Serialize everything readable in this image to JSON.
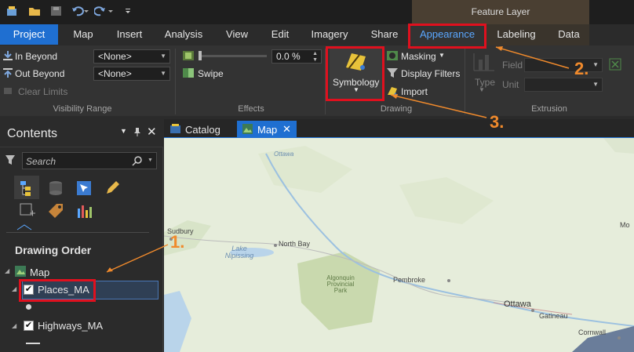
{
  "context_tab_group": "Feature Layer",
  "tabs": [
    "Project",
    "Map",
    "Insert",
    "Analysis",
    "View",
    "Edit",
    "Imagery",
    "Share",
    "Appearance",
    "Labeling",
    "Data"
  ],
  "ribbon": {
    "visibility_range": {
      "in_beyond": "In Beyond",
      "out_beyond": "Out Beyond",
      "clear_limits": "Clear Limits",
      "in_value": "<None>",
      "out_value": "<None>",
      "group_label": "Visibility Range"
    },
    "effects": {
      "transparency_value": "0.0 %",
      "swipe": "Swipe",
      "group_label": "Effects"
    },
    "drawing": {
      "symbology": "Symbology",
      "masking": "Masking",
      "display_filters": "Display Filters",
      "import": "Import",
      "group_label": "Drawing"
    },
    "extrusion": {
      "type": "Type",
      "field": "Field",
      "unit": "Unit",
      "group_label": "Extrusion"
    }
  },
  "contents": {
    "title": "Contents",
    "search_placeholder": "Search",
    "drawing_order": "Drawing Order",
    "map_label": "Map",
    "layers": [
      {
        "name": "Places_MA",
        "checked": true
      },
      {
        "name": "Highways_MA",
        "checked": true
      }
    ]
  },
  "view_tabs": [
    {
      "label": "Catalog"
    },
    {
      "label": "Map"
    }
  ],
  "map_labels": {
    "sudbury": "Sudbury",
    "north_bay": "North Bay",
    "lake_nipissing": "Lake Nipissing",
    "algonquin": "Algonquin Provincial Park",
    "pembroke": "Pembroke",
    "ottawa": "Ottawa",
    "gatineau": "Gatineau",
    "cornwall": "Cornwall",
    "ottawa_river": "Ottawa",
    "montreal_partial": "Mo"
  },
  "annotations": {
    "one": "1.",
    "two": "2.",
    "three": "3."
  },
  "colors": {
    "accent": "#1f6fd1",
    "highlight": "#e0101e",
    "callout": "#f08a2c",
    "appearance_tab": "#5aa7ff"
  }
}
